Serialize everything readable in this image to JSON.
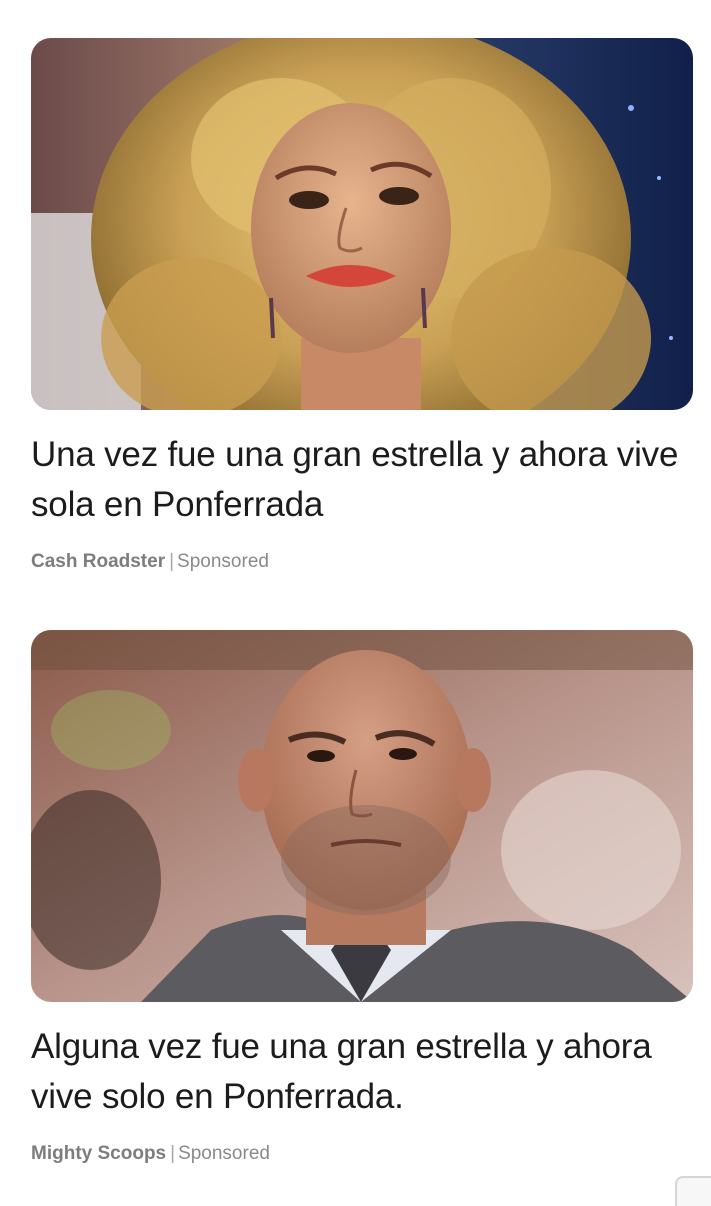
{
  "feed": {
    "items": [
      {
        "image_subject": "woman-with-curly-blonde-hair",
        "headline": "Una vez fue una gran estrella y ahora vive sola en Ponferrada",
        "source": "Cash Roadster",
        "separator": "|",
        "label": "Sponsored"
      },
      {
        "image_subject": "bald-man-in-suit",
        "headline": "Alguna vez fue una gran estrella y ahora vive solo en Ponferrada.",
        "source": "Mighty Scoops",
        "separator": "|",
        "label": "Sponsored"
      }
    ]
  }
}
